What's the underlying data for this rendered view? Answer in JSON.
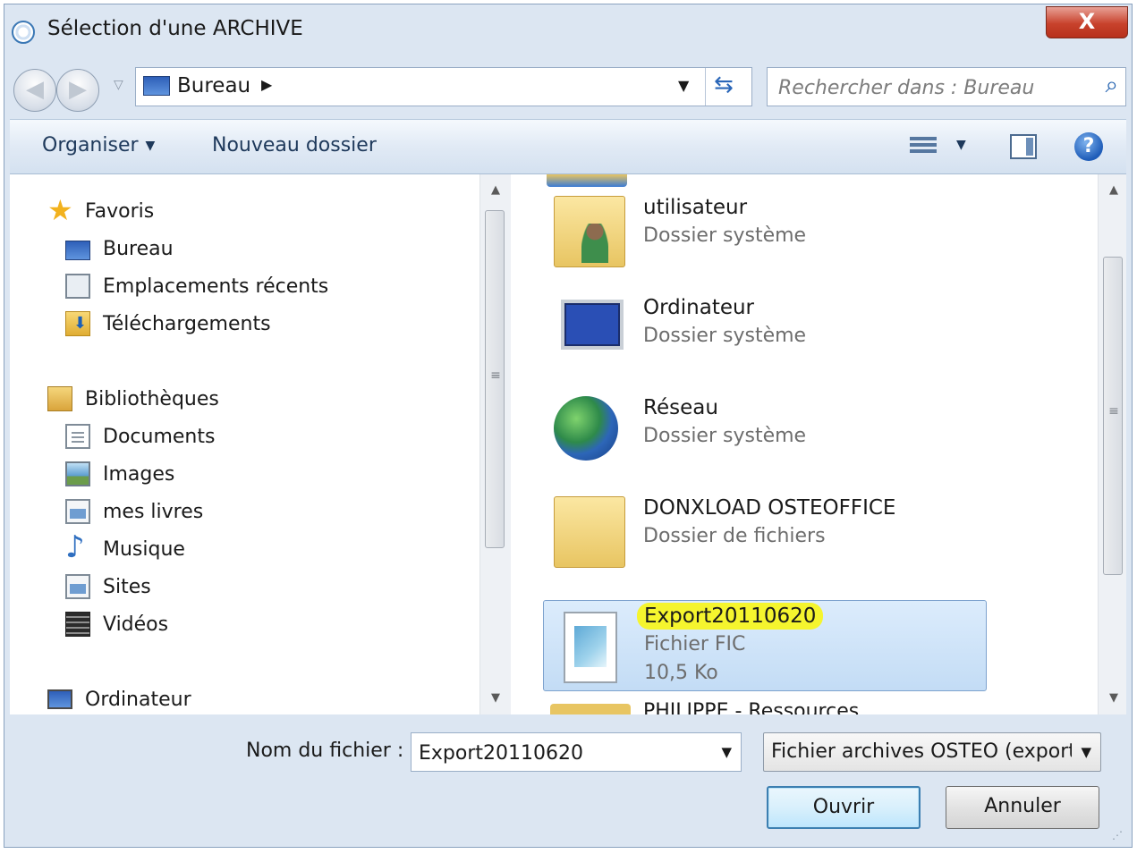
{
  "window": {
    "title": "Sélection d'une ARCHIVE",
    "close_label": "X"
  },
  "navbar": {
    "address": "Bureau",
    "search_placeholder": "Rechercher dans : Bureau"
  },
  "toolbar": {
    "organiser": "Organiser",
    "nouveau_dossier": "Nouveau dossier",
    "help": "?"
  },
  "sidebar": {
    "favoris": "Favoris",
    "bureau": "Bureau",
    "emplacements": "Emplacements récents",
    "telechargements": "Téléchargements",
    "bibliotheques": "Bibliothèques",
    "documents": "Documents",
    "images": "Images",
    "mes_livres": "mes livres",
    "musique": "Musique",
    "sites": "Sites",
    "videos": "Vidéos",
    "ordinateur": "Ordinateur"
  },
  "files": [
    {
      "name": "utilisateur",
      "type": "Dossier système",
      "icon": "user-folder-icon"
    },
    {
      "name": "Ordinateur",
      "type": "Dossier système",
      "icon": "computer-icon"
    },
    {
      "name": "Réseau",
      "type": "Dossier système",
      "icon": "network-icon"
    },
    {
      "name": "DONXLOAD OSTEOFFICE",
      "type": "Dossier de fichiers",
      "icon": "folder-icon"
    },
    {
      "name": "Export20110620",
      "type": "Fichier FIC",
      "size": "10,5 Ko",
      "icon": "file-icon",
      "selected": true
    }
  ],
  "partial_next": "PHILIPPE - Ressources",
  "bottom": {
    "filename_label": "Nom du fichier :",
    "filename_value": "Export20110620",
    "filetype": "Fichier archives OSTEO (export*",
    "open_button": "Ouvrir",
    "cancel_button": "Annuler"
  },
  "colors": {
    "chrome": "#dce6f2",
    "selection": "#c3dcf5",
    "highlight": "#f5f52e",
    "close_button": "#c8422c"
  }
}
